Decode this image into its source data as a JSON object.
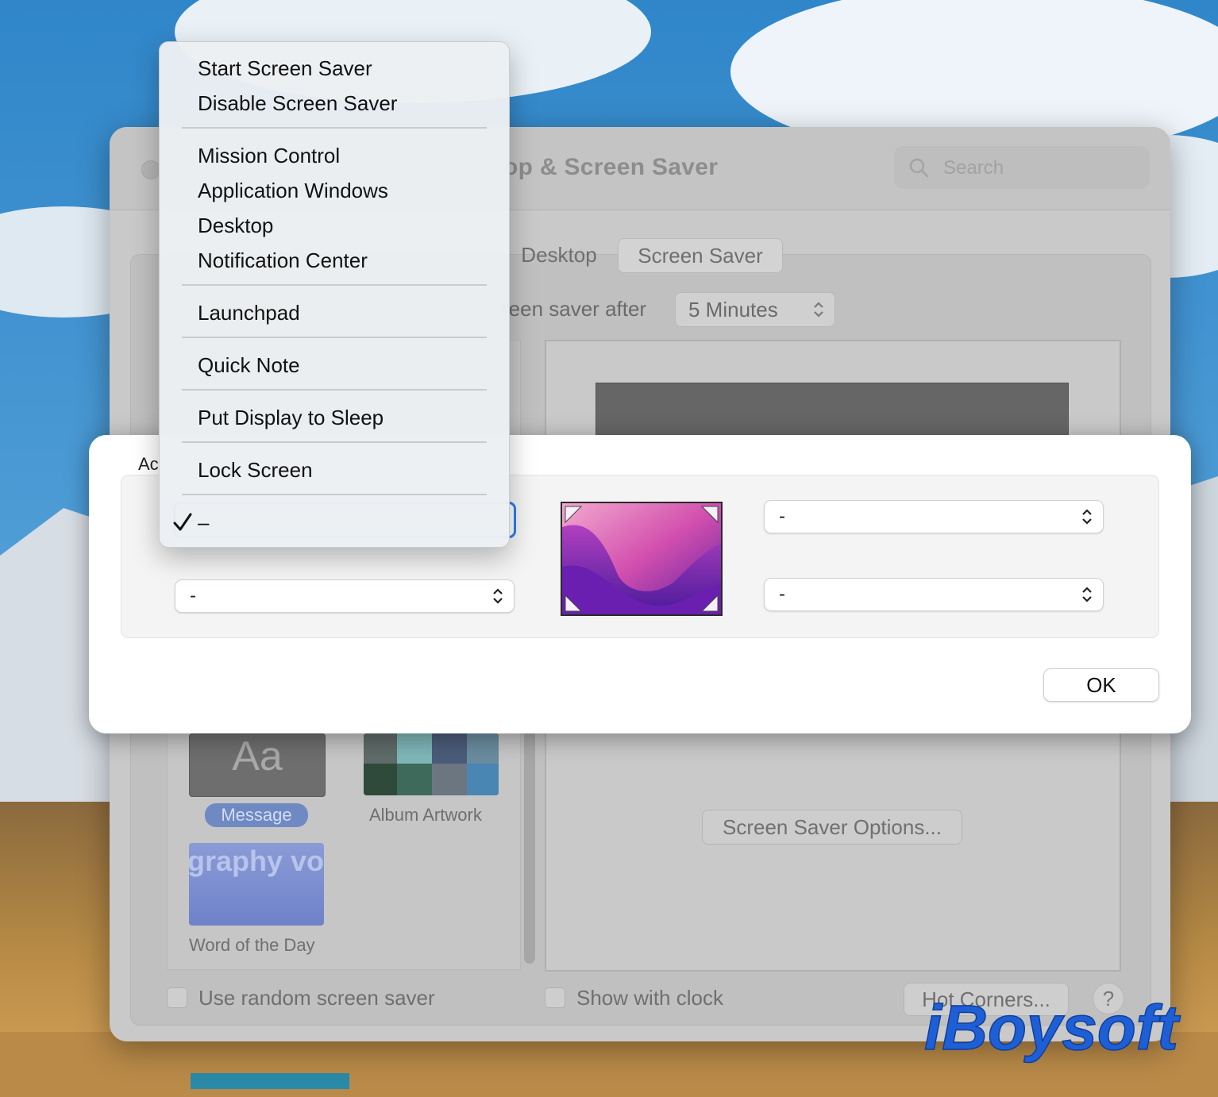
{
  "window": {
    "title": "Desktop & Screen Saver",
    "visible_title": "op & Screen Saver",
    "search_placeholder": "Search"
  },
  "tabs": [
    {
      "label": "Desktop",
      "selected": false
    },
    {
      "label": "Screen Saver",
      "selected": true
    }
  ],
  "start_after": {
    "label": "reen saver after",
    "value": "5 Minutes"
  },
  "screen_savers": [
    {
      "name": "Message",
      "selected": true,
      "thumb_text": "Aa"
    },
    {
      "name": "Album Artwork",
      "selected": false
    },
    {
      "name": "Word of the Day",
      "selected": false,
      "thumb_text": "graphy voca lexicog abulary"
    }
  ],
  "options_button": "Screen Saver Options...",
  "checkboxes": {
    "random": {
      "label": "Use random screen saver",
      "checked": false
    },
    "clock": {
      "label": "Show with clock",
      "checked": false
    }
  },
  "hot_corners_button": "Hot Corners...",
  "help_button": "?",
  "sheet": {
    "label": "Ac",
    "corners": {
      "top_left": "-",
      "bottom_left": "-",
      "top_right": "-",
      "bottom_right": "-"
    },
    "ok_label": "OK"
  },
  "menu": {
    "items": [
      {
        "label": "Start Screen Saver"
      },
      {
        "label": "Disable Screen Saver"
      },
      {
        "label": "Mission Control"
      },
      {
        "label": "Application Windows"
      },
      {
        "label": "Desktop"
      },
      {
        "label": "Notification Center"
      },
      {
        "label": "Launchpad"
      },
      {
        "label": "Quick Note"
      },
      {
        "label": "Put Display to Sleep"
      },
      {
        "label": "Lock Screen"
      },
      {
        "label": "–",
        "checked": true
      }
    ]
  },
  "watermark": "iBoysoft",
  "colors": {
    "accent": "#2b7cf0",
    "selection_badge": "#6f89c2",
    "watermark": "#1f5fd6"
  }
}
